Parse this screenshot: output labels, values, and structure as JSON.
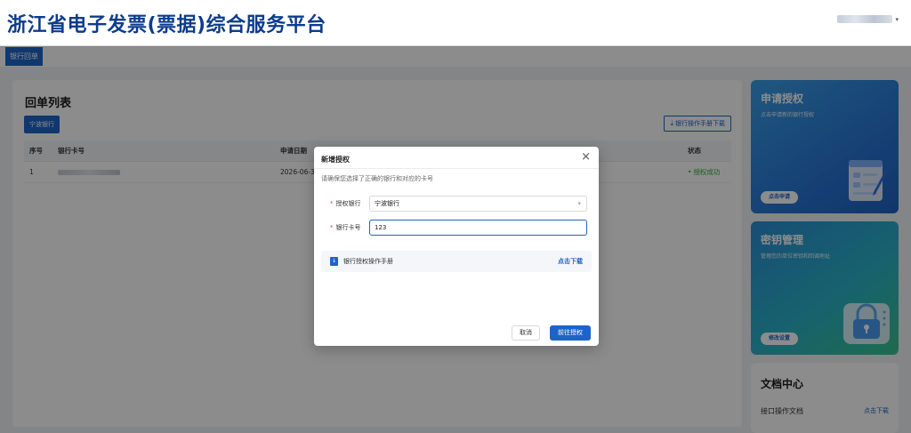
{
  "header": {
    "title": "浙江省电子发票(票据)综合服务平台"
  },
  "tabs": [
    {
      "label": "银行回单"
    }
  ],
  "main": {
    "heading": "回单列表",
    "bank_filter": "宁波银行",
    "manual_download": "银行操作手册下载",
    "table": {
      "columns": [
        "序号",
        "银行卡号",
        "申请日期",
        "状态"
      ],
      "rows": [
        {
          "no": "1",
          "card": "",
          "date": "2026-06-30",
          "status": "授权成功"
        }
      ]
    }
  },
  "side": {
    "auth": {
      "title": "申请授权",
      "subtitle": "点击申请新的银行授权",
      "button": "点击申请"
    },
    "keys": {
      "title": "密钥管理",
      "subtitle": "管理您的单位密钥和回调地址",
      "button": "修改设置"
    },
    "docs": {
      "title": "文档中心",
      "item": "接口操作文档",
      "link": "点击下载"
    }
  },
  "modal": {
    "title": "新增授权",
    "hint": "请确保您选择了正确的银行和对应的卡号",
    "bank_label": "授权银行",
    "bank_value": "宁波银行",
    "card_label": "银行卡号",
    "card_value": "123",
    "manual_name": "银行授权操作手册",
    "manual_link": "点击下载",
    "cancel": "取消",
    "confirm": "前往授权"
  },
  "colors": {
    "brand": "#1e64c8",
    "title": "#0d3c8c",
    "success": "#2fae3b",
    "required": "#e34d4d"
  }
}
